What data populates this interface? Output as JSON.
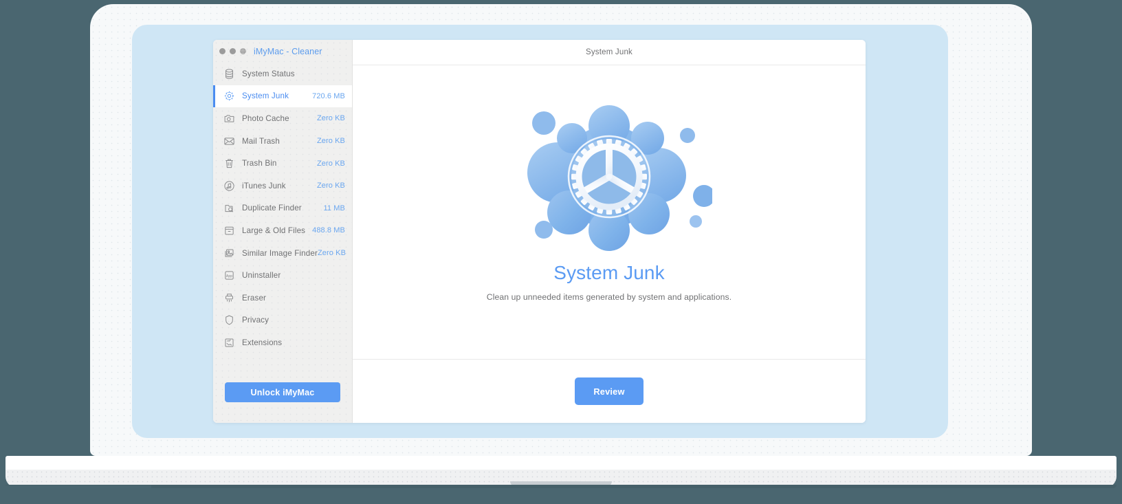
{
  "window": {
    "app_title": "iMyMac - Cleaner",
    "traffic_lights": [
      "close-dot",
      "minimize-dot",
      "zoom-dot"
    ]
  },
  "sidebar": {
    "items": [
      {
        "icon": "database-icon",
        "label": "System Status",
        "size": "",
        "active": false
      },
      {
        "icon": "gear-icon",
        "label": "System Junk",
        "size": "720.6 MB",
        "active": true
      },
      {
        "icon": "photo-camera-icon",
        "label": "Photo Cache",
        "size": "Zero KB",
        "active": false
      },
      {
        "icon": "mail-envelope-icon",
        "label": "Mail Trash",
        "size": "Zero KB",
        "active": false
      },
      {
        "icon": "trash-bin-icon",
        "label": "Trash Bin",
        "size": "Zero KB",
        "active": false
      },
      {
        "icon": "music-note-icon",
        "label": "iTunes Junk",
        "size": "Zero KB",
        "active": false
      },
      {
        "icon": "duplicate-search-icon",
        "label": "Duplicate Finder",
        "size": "11 MB",
        "active": false
      },
      {
        "icon": "archive-box-icon",
        "label": "Large & Old Files",
        "size": "488.8 MB",
        "active": false
      },
      {
        "icon": "image-stack-icon",
        "label": "Similar Image Finder",
        "size": "Zero KB",
        "active": false
      },
      {
        "icon": "app-box-icon",
        "label": "Uninstaller",
        "size": "",
        "active": false
      },
      {
        "icon": "shredder-icon",
        "label": "Eraser",
        "size": "",
        "active": false
      },
      {
        "icon": "shield-icon",
        "label": "Privacy",
        "size": "",
        "active": false
      },
      {
        "icon": "puzzle-piece-icon",
        "label": "Extensions",
        "size": "",
        "active": false
      }
    ],
    "unlock_label": "Unlock iMyMac"
  },
  "content": {
    "header_title": "System Junk",
    "illustration": "blue-blob-gear-illustration",
    "hero_title": "System Junk",
    "hero_subtitle": "Clean up unneeded items generated by system and applications.",
    "review_label": "Review"
  },
  "colors": {
    "accent_blue": "#5b9bf3",
    "link_blue": "#6aa6ef",
    "sidebar_bg": "#f0f0ef",
    "screen_bg": "#cfe6f5",
    "scene_bg": "#4a6670",
    "laptop_bg": "#f7f9fa",
    "text_gray": "#6f7072"
  }
}
